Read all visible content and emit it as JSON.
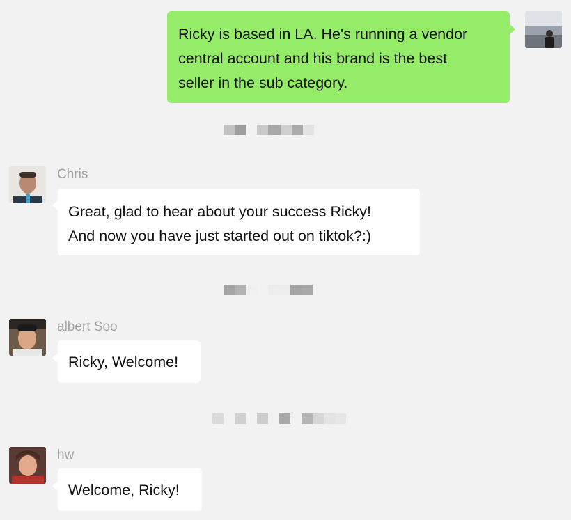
{
  "messages": [
    {
      "sender": "",
      "side": "self",
      "lines": [
        "Ricky is based in LA. He's running a vendor",
        "central account and his brand is the best",
        "seller in the sub category."
      ]
    },
    {
      "sender": "Chris",
      "side": "other",
      "lines": [
        "Great, glad to hear about your success Ricky!",
        "And now you have just started out on tiktok?:)"
      ]
    },
    {
      "sender": "albert Soo",
      "side": "other",
      "lines": [
        "Ricky, Welcome!"
      ]
    },
    {
      "sender": "hw",
      "side": "other",
      "lines": [
        "Welcome, Ricky!"
      ]
    }
  ],
  "colors": {
    "background": "#f2f2f2",
    "self_bubble": "#95ec69",
    "other_bubble": "#ffffff",
    "sender_name": "#a3a3a3",
    "redaction_mosaic": "#bdbdbd"
  },
  "icons": {
    "self_avatar": "avatar-photo-icon",
    "chris_avatar": "avatar-photo-icon",
    "albert_avatar": "avatar-photo-icon",
    "hw_avatar": "avatar-photo-icon"
  }
}
